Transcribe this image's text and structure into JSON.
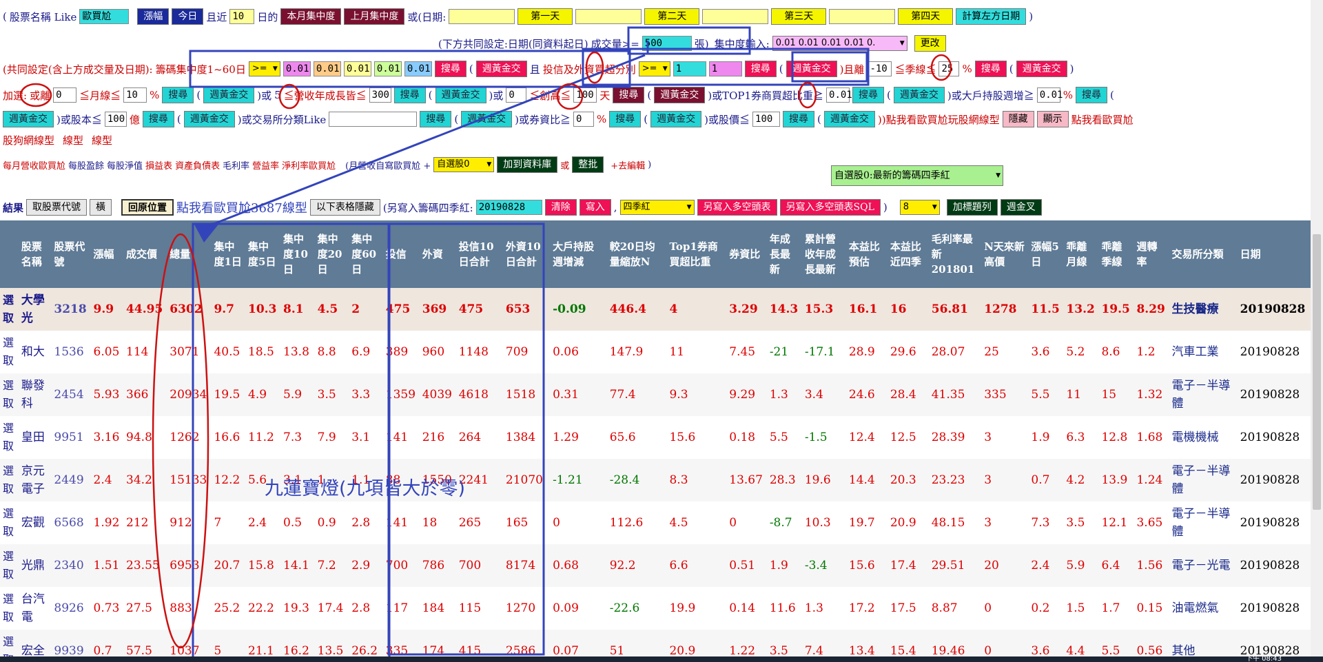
{
  "row1": {
    "open_paren": "(",
    "name_like_label": "股票名稱 Like",
    "name_like_value": "歐買尬",
    "sort_price_btn": "漲幅",
    "today_btn": "今日",
    "recent_label": "且近",
    "recent_value": "10",
    "day_label": "日的",
    "this_month_btn": "本月集中度",
    "last_month_btn": "上月集中度",
    "or_date_label": "或(日期:",
    "day1_btn": "第一天",
    "day2_btn": "第二天",
    "day3_btn": "第三天",
    "day4_btn": "第四天",
    "calc_btn": "計算左方日期",
    "close_paren": ")"
  },
  "row2": {
    "common_setting": "(下方共同設定:日期(同資料起日)",
    "volume_label": "成交量>=",
    "volume_value": "500",
    "unit": "張)",
    "conc_input_label": "集中度輸入:",
    "conc_select": "0.01 0.01 0.01 0.01 0.",
    "change_btn": "更改"
  },
  "row3": {
    "prefix": "(共同設定(含上方成交量及日期):",
    "conc_label": "籌碼集中度1~60日",
    "op": ">=",
    "v1": "0.01",
    "v2": "0.01",
    "v3": "0.01",
    "v4": "0.01",
    "v5": "0.01",
    "search_btn": "搜尋",
    "paren": "(",
    "gold_btn": "週黃金交",
    "and_label": "且",
    "invest_label": "投信及外資買超分別",
    "op2": ">=",
    "iv1": "1",
    "iv2": "1",
    "search_btn2": "搜尋",
    "paren2": "(",
    "gold_btn2": "週黃金交",
    "and_dist": ")且離",
    "dist_value": "-10",
    "season_label": "≦季線≦",
    "season_value": "25",
    "pct": "%",
    "search_btn3": "搜尋",
    "paren3": "(",
    "gold_btn3": "週黃金交",
    "end": ")"
  },
  "row4": {
    "add_label": "加選:",
    "or_dist": "或離",
    "dist_value": "0",
    "month_label": "≦月線≦",
    "month_value": "10",
    "pct": "%",
    "search": "搜尋",
    "p": "(",
    "gold": "週黃金交",
    "or5": ")或",
    "or5_suffix": "5",
    "rev_label": "≦營收年成長皆≦",
    "rev_value": "300",
    "search2": "搜尋",
    "p2": "(",
    "gold2": "週黃金交",
    "or_low": ")或",
    "low_value": "0",
    "new_high": "≦創高≦",
    "new_high_value": "100",
    "day": "天",
    "search3": "搜尋",
    "p3": "(",
    "gold3": "週黃金交",
    "top1": ")或TOP1券商買超比重≧",
    "top1_value": "0.01",
    "search4": "搜尋",
    "p4": "(",
    "gold4": "週黃金交",
    "big_holder": ")或大戶持股週增≧",
    "big_value": "0.01",
    "search5": "搜尋",
    "p5": "("
  },
  "row5": {
    "gold": "週黃金交",
    "capital": ")或股本≦",
    "capital_value": "100",
    "unit": "億",
    "search": "搜尋",
    "p": "(",
    "gold2": "週黃金交",
    "industry": ")或交易所分類Like",
    "industry_value": "",
    "search2": "搜尋",
    "p2": "(",
    "gold3": "週黃金交",
    "margin": ")或券資比≧",
    "margin_value": "0",
    "pct": "%",
    "search3": "搜尋",
    "p3": "(",
    "gold4": "週黃金交",
    "price": ")或股價≦",
    "price_value": "100",
    "search4": "搜尋",
    "p4": "(",
    "gold5": "週黃金交",
    "see_link": "))點我看歐買尬玩股網線型",
    "hide_btn": "隱藏",
    "show_btn": "顯示",
    "see_link2": "點我看歐買尬"
  },
  "row6": {
    "line1": "股狗網線型",
    "line2": "線型",
    "line3": "線型"
  },
  "row7": {
    "links": [
      "每月營收歐買尬",
      "每股盈餘",
      "每股淨值",
      "損益表",
      "資產負債表",
      "毛利率",
      "營益率",
      "淨利率歐買尬"
    ],
    "paren": "(月營收自寫歐買尬 +",
    "self_select": "自選股0",
    "add_db": "加到資料庫",
    "or": "或",
    "batch": "整批",
    "edit": "+去編輯",
    "close": ")"
  },
  "row7b": {
    "latest_select": "自選股0:最新的籌碼四季紅"
  },
  "row8": {
    "result": "結果",
    "take_code": "取股票代號",
    "horizontal": "橫",
    "restore": "回原位置",
    "see3687": "點我看歐買尬3687線型",
    "hide_table": "以下表格隱藏",
    "write_label": "(另寫入籌碼四季紅:",
    "write_value": "20190828",
    "clear": "清除",
    "write": "寫入",
    "comma": ",",
    "four_season": "四季紅",
    "write_ls": "另寫入多空頭表",
    "write_ls_sql": "另寫入多空頭表SQL",
    "close": ")",
    "count_select": "8",
    "add_title": "加標題列",
    "weekly_gold": "週金叉"
  },
  "annotation": {
    "text": "九蓮寶燈(九項皆大於零)",
    "color": "#3344bb"
  },
  "table": {
    "headers": [
      "",
      "股票名稱",
      "股票代號",
      "漲幅",
      "成交價",
      "總量",
      "集中度1日",
      "集中度5日",
      "集中度10日",
      "集中度20日",
      "集中度60日",
      "投信",
      "外資",
      "投信10日合計",
      "外資10日合計",
      "大戶持股週增減",
      "較20日均量縮放N",
      "Top1券商買超比重",
      "券資比",
      "年成長最新",
      "累計營收年成長最新",
      "本益比預估",
      "本益比近四季",
      "毛利率最新201801",
      "N天來新高價",
      "漲幅5日",
      "乖離月線",
      "乖離季線",
      "週轉率",
      "交易所分類",
      "日期"
    ],
    "rows": [
      [
        "選取",
        "大學光",
        "3218",
        "9.9",
        "44.95",
        "6302",
        "9.7",
        "10.3",
        "8.1",
        "4.5",
        "2",
        "475",
        "369",
        "475",
        "653",
        "-0.09",
        "446.4",
        "4",
        "3.29",
        "14.3",
        "15.3",
        "16.1",
        "16",
        "56.81",
        "1278",
        "11.5",
        "13.2",
        "19.5",
        "8.29",
        "生技醫療",
        "20190828"
      ],
      [
        "選取",
        "和大",
        "1536",
        "6.05",
        "114",
        "3071",
        "40.5",
        "18.5",
        "13.8",
        "8.8",
        "6.9",
        "389",
        "960",
        "1148",
        "709",
        "0.06",
        "147.9",
        "11",
        "7.45",
        "-21",
        "-17.1",
        "28.9",
        "29.6",
        "28.07",
        "25",
        "3.6",
        "5.2",
        "8.6",
        "1.2",
        "汽車工業",
        "20190828"
      ],
      [
        "選取",
        "聯發科",
        "2454",
        "5.93",
        "366",
        "20934",
        "19.5",
        "4.9",
        "5.9",
        "3.5",
        "3.3",
        "1359",
        "4039",
        "4618",
        "1518",
        "0.31",
        "77.4",
        "9.3",
        "9.29",
        "1.3",
        "3.4",
        "24.6",
        "28.4",
        "41.35",
        "335",
        "5.5",
        "11",
        "15",
        "1.32",
        "電子－半導體",
        "20190828"
      ],
      [
        "選取",
        "皇田",
        "9951",
        "3.16",
        "94.8",
        "1262",
        "16.6",
        "11.2",
        "7.3",
        "7.9",
        "3.1",
        "141",
        "216",
        "264",
        "1384",
        "1.29",
        "65.6",
        "15.6",
        "0.18",
        "5.5",
        "-1.5",
        "12.4",
        "12.5",
        "28.39",
        "3",
        "1.9",
        "6.3",
        "12.8",
        "1.68",
        "電機機械",
        "20190828"
      ],
      [
        "選取",
        "京元電子",
        "2449",
        "2.4",
        "34.2",
        "15133",
        "12.2",
        "5.6",
        "3.1",
        "1",
        "1.1",
        "88",
        "1550",
        "2241",
        "21070",
        "-1.21",
        "-28.4",
        "8.3",
        "13.67",
        "28.3",
        "19.6",
        "14.4",
        "20.3",
        "23.23",
        "3",
        "0.7",
        "4.2",
        "13.9",
        "1.24",
        "電子－半導體",
        "20190828"
      ],
      [
        "選取",
        "宏觀",
        "6568",
        "1.92",
        "212",
        "912",
        "7",
        "2.4",
        "0.5",
        "0.9",
        "2.8",
        "141",
        "18",
        "265",
        "165",
        "0",
        "112.6",
        "4.5",
        "0",
        "-8.7",
        "10.3",
        "19.7",
        "20.9",
        "48.15",
        "3",
        "7.3",
        "3.5",
        "12.1",
        "3.65",
        "電子－半導體",
        "20190828"
      ],
      [
        "選取",
        "光鼎",
        "2340",
        "1.51",
        "23.55",
        "6953",
        "20.7",
        "15.8",
        "14.1",
        "7.2",
        "2.9",
        "700",
        "786",
        "700",
        "8174",
        "0.68",
        "92.2",
        "6.6",
        "0.51",
        "1.9",
        "-3.4",
        "15.6",
        "17.4",
        "29.51",
        "20",
        "2.4",
        "5.9",
        "6.4",
        "1.56",
        "電子－光電",
        "20190828"
      ],
      [
        "選取",
        "台汽電",
        "8926",
        "0.73",
        "27.5",
        "883",
        "25.2",
        "22.2",
        "19.3",
        "17.4",
        "2.8",
        "117",
        "184",
        "115",
        "1270",
        "0.09",
        "-22.6",
        "19.9",
        "0.14",
        "11.6",
        "1.3",
        "17.2",
        "17.5",
        "8.87",
        "0",
        "0.2",
        "1.5",
        "1.7",
        "0.15",
        "油電燃氣",
        "20190828"
      ],
      [
        "選取",
        "宏全",
        "9939",
        "0.7",
        "57.5",
        "1037",
        "5",
        "21.1",
        "16.2",
        "13.5",
        "26.2",
        "335",
        "174",
        "415",
        "2586",
        "0.07",
        "51",
        "20.9",
        "1.22",
        "3.5",
        "7.4",
        "13.4",
        "15.4",
        "19.46",
        "0",
        "3.6",
        "4.4",
        "5.5",
        "0.56",
        "其他",
        "20190828"
      ]
    ]
  },
  "taskbar": {
    "clock": "下午 08:43"
  }
}
